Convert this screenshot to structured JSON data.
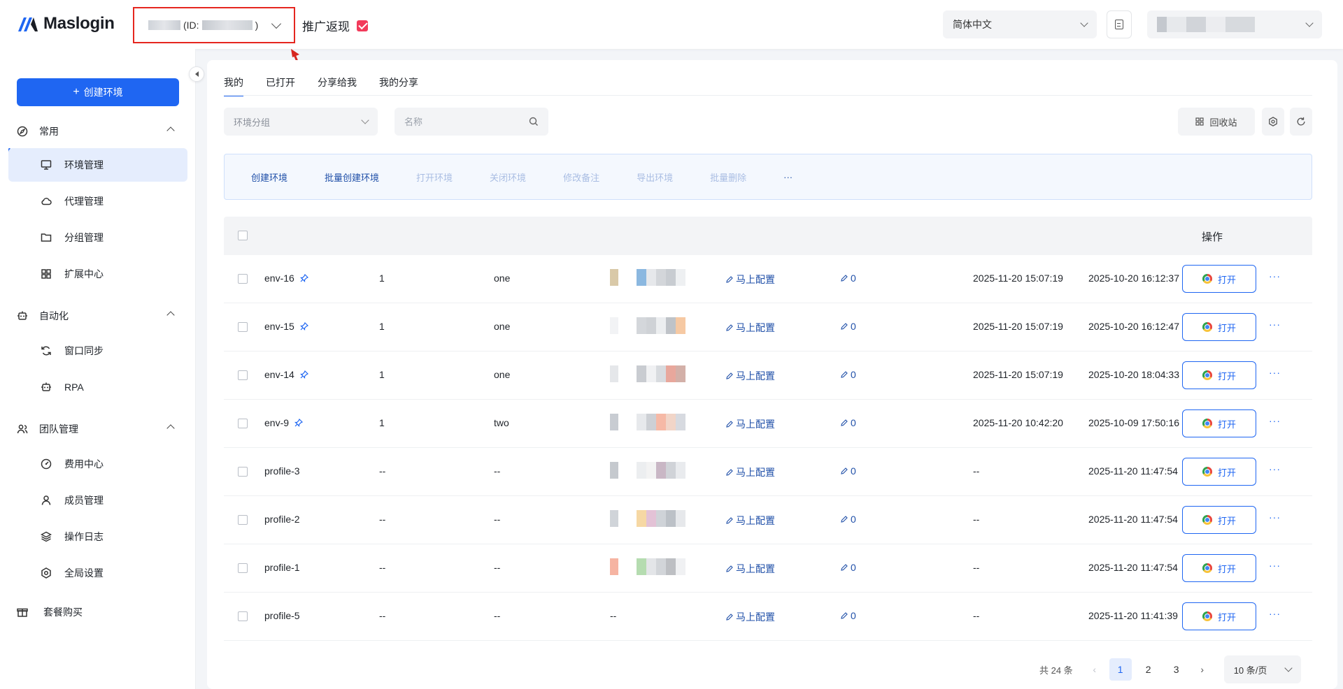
{
  "header": {
    "logo_text": "Maslogin",
    "account_id_prefix": "(ID:",
    "account_id_suffix": ")",
    "promo_label": "推广返现",
    "language": "简体中文"
  },
  "sidebar": {
    "create_button": "创建环境",
    "groups": [
      {
        "label": "常用",
        "items": [
          "环境管理",
          "代理管理",
          "分组管理",
          "扩展中心"
        ]
      },
      {
        "label": "自动化",
        "items": [
          "窗口同步",
          "RPA"
        ]
      },
      {
        "label": "团队管理",
        "items": [
          "费用中心",
          "成员管理",
          "操作日志",
          "全局设置"
        ]
      }
    ],
    "purchase": "套餐购买",
    "active_item": "环境管理"
  },
  "main": {
    "tabs": [
      "我的",
      "已打开",
      "分享给我",
      "我的分享"
    ],
    "active_tab": "我的",
    "group_placeholder": "环境分组",
    "search_placeholder": "名称",
    "recycle_label": "回收站",
    "actions": [
      {
        "label": "创建环境",
        "enabled": true
      },
      {
        "label": "批量创建环境",
        "enabled": true
      },
      {
        "label": "打开环境",
        "enabled": false
      },
      {
        "label": "关闭环境",
        "enabled": false
      },
      {
        "label": "修改备注",
        "enabled": false
      },
      {
        "label": "导出环境",
        "enabled": false
      },
      {
        "label": "批量删除",
        "enabled": false
      },
      {
        "label": "···",
        "enabled": true
      }
    ],
    "table": {
      "ops_header": "操作",
      "config_label": "马上配置",
      "open_label": "打开",
      "more_label": "···",
      "rows": [
        {
          "name": "env-16",
          "pinned": true,
          "c2": "1",
          "c3": "one",
          "has_pix": true,
          "count": "0",
          "t1": "2025-11-20 15:07:19",
          "t2": "2025-10-20 16:12:37"
        },
        {
          "name": "env-15",
          "pinned": true,
          "c2": "1",
          "c3": "one",
          "has_pix": true,
          "count": "0",
          "t1": "2025-11-20 15:07:19",
          "t2": "2025-10-20 16:12:47"
        },
        {
          "name": "env-14",
          "pinned": true,
          "c2": "1",
          "c3": "one",
          "has_pix": true,
          "count": "0",
          "t1": "2025-11-20 15:07:19",
          "t2": "2025-10-20 18:04:33"
        },
        {
          "name": "env-9",
          "pinned": true,
          "c2": "1",
          "c3": "two",
          "has_pix": true,
          "count": "0",
          "t1": "2025-11-20 10:42:20",
          "t2": "2025-10-09 17:50:16"
        },
        {
          "name": "profile-3",
          "pinned": false,
          "c2": "--",
          "c3": "--",
          "has_pix": true,
          "count": "0",
          "t1": "--",
          "t2": "2025-11-20 11:47:54"
        },
        {
          "name": "profile-2",
          "pinned": false,
          "c2": "--",
          "c3": "--",
          "has_pix": true,
          "count": "0",
          "t1": "--",
          "t2": "2025-11-20 11:47:54"
        },
        {
          "name": "profile-1",
          "pinned": false,
          "c2": "--",
          "c3": "--",
          "has_pix": true,
          "count": "0",
          "t1": "--",
          "t2": "2025-11-20 11:47:54"
        },
        {
          "name": "profile-5",
          "pinned": false,
          "c2": "--",
          "c3": "--",
          "has_pix": false,
          "pix_text": "--",
          "count": "0",
          "t1": "--",
          "t2": "2025-11-20 11:41:39"
        }
      ]
    },
    "pagination": {
      "total": "共 24 条",
      "pages": [
        "1",
        "2",
        "3"
      ],
      "current": "1",
      "prev": "‹",
      "next": "›",
      "page_size": "10 条/页"
    }
  },
  "colors": {
    "accent": "#1f66f2",
    "highlight_border": "#e5261f"
  }
}
